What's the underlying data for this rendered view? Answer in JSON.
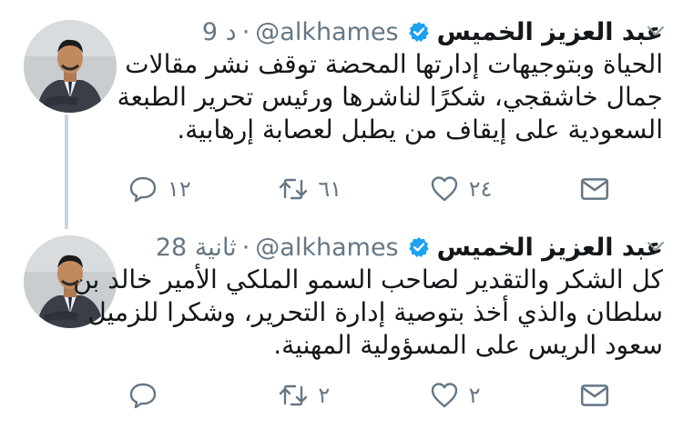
{
  "tweets": [
    {
      "name": "عبد العزيز الخميس",
      "handle": "@alkhames",
      "time": "9 د",
      "body_lines": [
        "الحياة وبتوجيهات إدارتها المحضة توقف نشر مقالات",
        "جمال خاشقجي، شكرًا لناشرها ورئيس تحرير الطبعة",
        "السعودية على إيقاف من يطبل لعصابة إرهابية."
      ],
      "reply_count": "١٢",
      "retweet_count": "٦١",
      "like_count": "٢٤"
    },
    {
      "name": "عبد العزيز الخميس",
      "handle": "@alkhames",
      "time": "28 ثانية",
      "body_lines": [
        "كل الشكر والتقدير لصاحب السمو الملكي الأمير خالد بن",
        "سلطان والذي أخذ بتوصية إدارة التحرير، وشكرا للزميل",
        "سعود الريس على المسؤولية المهنية."
      ],
      "reply_count": "",
      "retweet_count": "٢",
      "like_count": "٢"
    }
  ],
  "colors": {
    "text": "#14171a",
    "meta": "#657786",
    "verified": "#1da1f2",
    "thread_line": "#ccd6dd"
  },
  "icons": [
    "chevron-down-icon",
    "verified-badge-icon",
    "reply-icon",
    "retweet-icon",
    "like-icon",
    "direct-message-icon"
  ]
}
